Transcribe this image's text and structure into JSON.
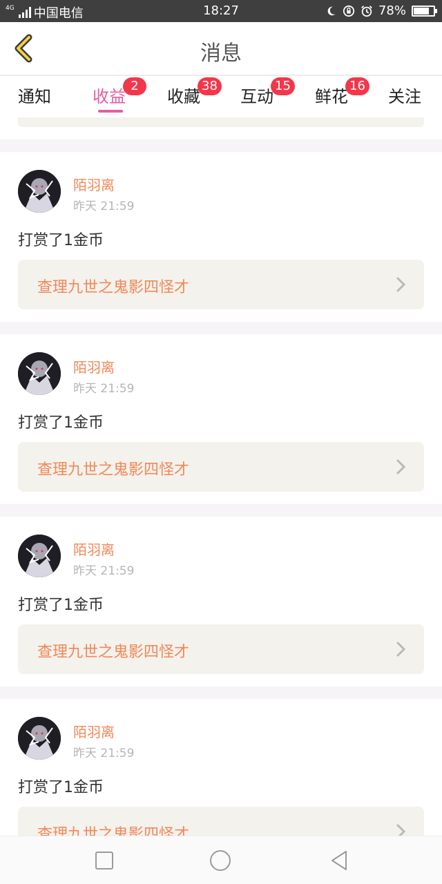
{
  "status_bar": {
    "network_tag": "4G",
    "carrier": "中国电信",
    "time": "18:27",
    "battery": "78%",
    "battery_level": 0.78,
    "icons": [
      "moon-icon",
      "rotation-lock-icon",
      "alarm-icon",
      "battery-icon"
    ]
  },
  "header": {
    "title": "消息",
    "back_icon": "chevron-left-icon"
  },
  "tabs": [
    {
      "label": "通知",
      "badge": ""
    },
    {
      "label": "收益",
      "badge": "2",
      "active": true
    },
    {
      "label": "收藏",
      "badge": "38"
    },
    {
      "label": "互动",
      "badge": "15"
    },
    {
      "label": "鲜花",
      "badge": "16"
    },
    {
      "label": "关注",
      "badge": ""
    }
  ],
  "messages": [
    {
      "user": "陌羽离",
      "time": "昨天 21:59",
      "text": "打赏了1金币",
      "book": "查理九世之鬼影四怪才"
    },
    {
      "user": "陌羽离",
      "time": "昨天 21:59",
      "text": "打赏了1金币",
      "book": "查理九世之鬼影四怪才"
    },
    {
      "user": "陌羽离",
      "time": "昨天 21:59",
      "text": "打赏了1金币",
      "book": "查理九世之鬼影四怪才"
    },
    {
      "user": "陌羽离",
      "time": "昨天 21:59",
      "text": "打赏了1金币",
      "book": "查理九世之鬼影四怪才"
    }
  ],
  "colors": {
    "accent_pink": "#e45ea0",
    "badge_red": "#f2374b",
    "username_orange": "#f0885a",
    "card_bg": "#f4f2ec"
  },
  "nav_bar": {
    "icons": [
      "recent-apps-icon",
      "home-icon",
      "back-icon"
    ]
  }
}
